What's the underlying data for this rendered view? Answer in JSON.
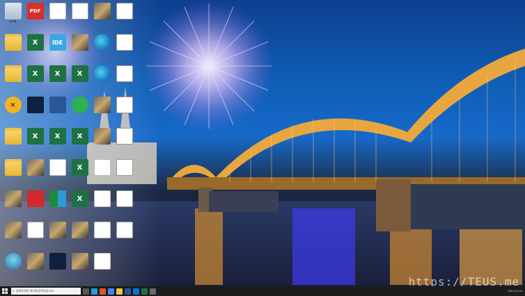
{
  "colors": {
    "taskbar": "#1c1c1c",
    "sky": "#1565c0",
    "bridge_light": "#e8a640"
  },
  "desktop": {
    "icons": [
      {
        "label": "휴지통",
        "kind": "recycle",
        "glyph": ""
      },
      {
        "label": "",
        "kind": "pdf",
        "glyph": "PDF"
      },
      {
        "label": "",
        "kind": "doc",
        "glyph": ""
      },
      {
        "label": "",
        "kind": "blankwin",
        "glyph": ""
      },
      {
        "label": "",
        "kind": "photo",
        "glyph": ""
      },
      {
        "label": "",
        "kind": "blankwin",
        "glyph": ""
      },
      {
        "label": "",
        "kind": "folder",
        "glyph": ""
      },
      {
        "label": "",
        "kind": "excel",
        "glyph": "X"
      },
      {
        "label": "",
        "kind": "ide",
        "glyph": "IDE"
      },
      {
        "label": "",
        "kind": "photo",
        "glyph": ""
      },
      {
        "label": "",
        "kind": "edge",
        "glyph": ""
      },
      {
        "label": "",
        "kind": "blankwin",
        "glyph": ""
      },
      {
        "label": "",
        "kind": "folder",
        "glyph": ""
      },
      {
        "label": "",
        "kind": "excel",
        "glyph": "X"
      },
      {
        "label": "",
        "kind": "excel",
        "glyph": "X"
      },
      {
        "label": "",
        "kind": "excel",
        "glyph": "X"
      },
      {
        "label": "",
        "kind": "edge",
        "glyph": ""
      },
      {
        "label": "",
        "kind": "blankwin",
        "glyph": ""
      },
      {
        "label": "",
        "kind": "orange-round",
        "glyph": "×"
      },
      {
        "label": "",
        "kind": "dark-app",
        "glyph": ""
      },
      {
        "label": "",
        "kind": "word",
        "glyph": ""
      },
      {
        "label": "",
        "kind": "green-round",
        "glyph": ""
      },
      {
        "label": "",
        "kind": "photo",
        "glyph": ""
      },
      {
        "label": "",
        "kind": "list-ic",
        "glyph": ""
      },
      {
        "label": "",
        "kind": "folder",
        "glyph": ""
      },
      {
        "label": "",
        "kind": "excel",
        "glyph": "X"
      },
      {
        "label": "",
        "kind": "excel",
        "glyph": "X"
      },
      {
        "label": "",
        "kind": "excel",
        "glyph": "X"
      },
      {
        "label": "",
        "kind": "photo",
        "glyph": ""
      },
      {
        "label": "",
        "kind": "blankwin",
        "glyph": ""
      },
      {
        "label": "",
        "kind": "folder",
        "glyph": ""
      },
      {
        "label": "",
        "kind": "photo",
        "glyph": ""
      },
      {
        "label": "",
        "kind": "doc",
        "glyph": ""
      },
      {
        "label": "",
        "kind": "excel",
        "glyph": "X"
      },
      {
        "label": "",
        "kind": "doc",
        "glyph": ""
      },
      {
        "label": "",
        "kind": "blankwin",
        "glyph": ""
      },
      {
        "label": "",
        "kind": "photo",
        "glyph": ""
      },
      {
        "label": "",
        "kind": "red-app",
        "glyph": ""
      },
      {
        "label": "",
        "kind": "teal",
        "glyph": ""
      },
      {
        "label": "",
        "kind": "excel",
        "glyph": "X"
      },
      {
        "label": "",
        "kind": "doc",
        "glyph": ""
      },
      {
        "label": "",
        "kind": "blankwin",
        "glyph": ""
      },
      {
        "label": "",
        "kind": "photo",
        "glyph": ""
      },
      {
        "label": "",
        "kind": "blankwin",
        "glyph": ""
      },
      {
        "label": "",
        "kind": "photo",
        "glyph": ""
      },
      {
        "label": "",
        "kind": "photo",
        "glyph": ""
      },
      {
        "label": "",
        "kind": "doc",
        "glyph": ""
      },
      {
        "label": "",
        "kind": "blankwin",
        "glyph": ""
      },
      {
        "label": "",
        "kind": "avatar-app",
        "glyph": ""
      },
      {
        "label": "",
        "kind": "photo",
        "glyph": ""
      },
      {
        "label": "",
        "kind": "dark-app",
        "glyph": ""
      },
      {
        "label": "",
        "kind": "photo",
        "glyph": ""
      },
      {
        "label": "",
        "kind": "doc",
        "glyph": ""
      }
    ]
  },
  "taskbar": {
    "search_placeholder": "검색하려면 여기에 입력하십시오.",
    "time": "",
    "date": "2021-02-03"
  },
  "watermark": "https://TEUS.me"
}
